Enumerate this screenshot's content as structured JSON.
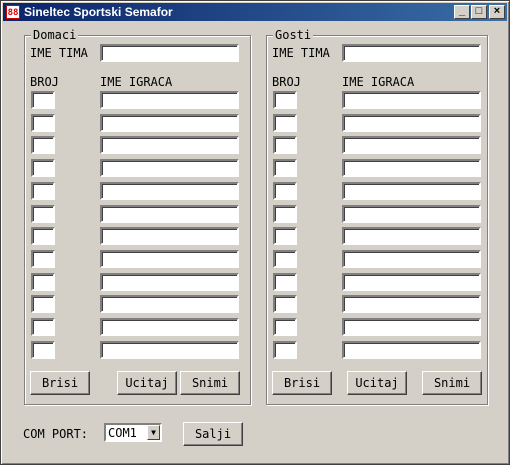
{
  "window": {
    "title": "Sineltec Sportski Semafor",
    "icon_text": "88",
    "minimize": "_",
    "maximize": "□",
    "close": "×"
  },
  "home": {
    "group_title": "Domaci",
    "team_name_label": "IME TIMA",
    "team_name_value": "",
    "number_header": "BROJ",
    "player_header": "IME IGRACA",
    "rows": 12,
    "buttons": {
      "clear": "Brisi",
      "load": "Ucitaj",
      "save": "Snimi"
    }
  },
  "guests": {
    "group_title": "Gosti",
    "team_name_label": "IME TIMA",
    "team_name_value": "",
    "number_header": "BROJ",
    "player_header": "IME IGRACA",
    "rows": 12,
    "buttons": {
      "clear": "Brisi",
      "load": "Ucitaj",
      "save": "Snimi"
    }
  },
  "bottom": {
    "com_port_label": "COM PORT:",
    "com_port_value": "COM1",
    "send_label": "Salji"
  },
  "icons": {
    "dropdown": "chevron-down-icon",
    "app": "scoreboard-icon"
  }
}
